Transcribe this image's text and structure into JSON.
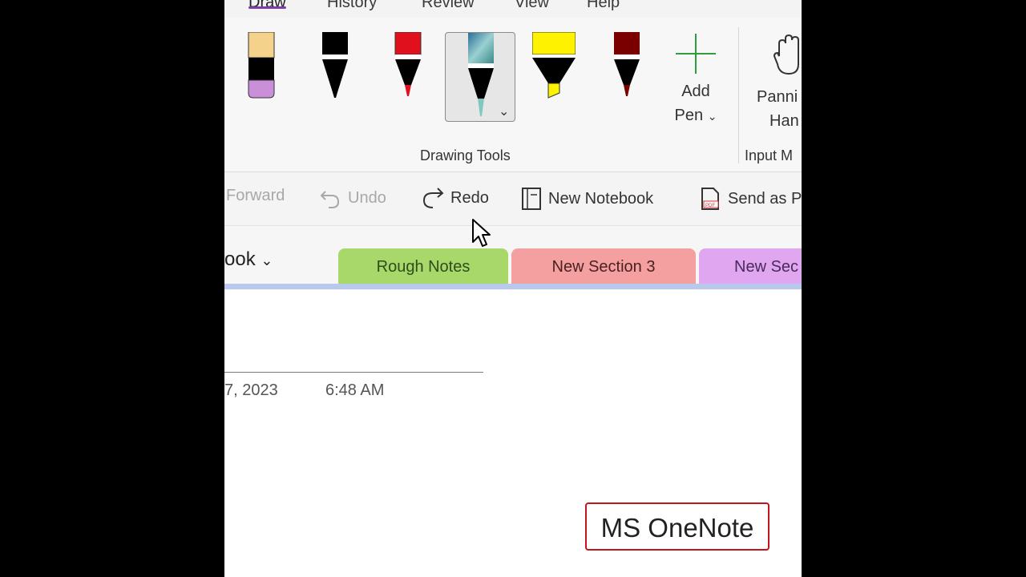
{
  "ribbon_tabs": [
    "Draw",
    "History",
    "Review",
    "View",
    "Help"
  ],
  "ribbon": {
    "pens": [
      {
        "name": "highlighter-peach-lilac",
        "colors": [
          "#f5d28c",
          "#000000",
          "#c98fd8"
        ]
      },
      {
        "name": "pen-black",
        "colors": [
          "#000000"
        ]
      },
      {
        "name": "pen-red",
        "colors": [
          "#e0111c"
        ]
      },
      {
        "name": "pen-galaxy",
        "colors": [
          "#5aa0c8",
          "#9ad0d0"
        ],
        "selected": true
      },
      {
        "name": "highlighter-yellow",
        "colors": [
          "#fff200"
        ]
      },
      {
        "name": "pen-dark-red",
        "colors": [
          "#7a0000"
        ]
      }
    ],
    "add_pen": {
      "line1": "Add",
      "line2": "Pen"
    },
    "group_label": "Drawing Tools",
    "panning": {
      "line1": "Panni",
      "line2": "Han"
    },
    "input_label": "Input M"
  },
  "quick_access": {
    "forward": "Forward",
    "undo": "Undo",
    "redo": "Redo",
    "new_notebook": "New Notebook",
    "send_as": "Send as P"
  },
  "notebook": {
    "name_fragment": "ook"
  },
  "sections": [
    {
      "label": "Rough Notes",
      "color": "#a8d86a",
      "text_color": "#2f4d1a"
    },
    {
      "label": "New Section 3",
      "color": "#f5a0a0",
      "text_color": "#4a2020"
    },
    {
      "label": "New Sec",
      "color": "#e0a6f0",
      "text_color": "#4a2a5a"
    }
  ],
  "page": {
    "date": "7, 2023",
    "time": "6:48 AM"
  },
  "watermark": "MS OneNote"
}
